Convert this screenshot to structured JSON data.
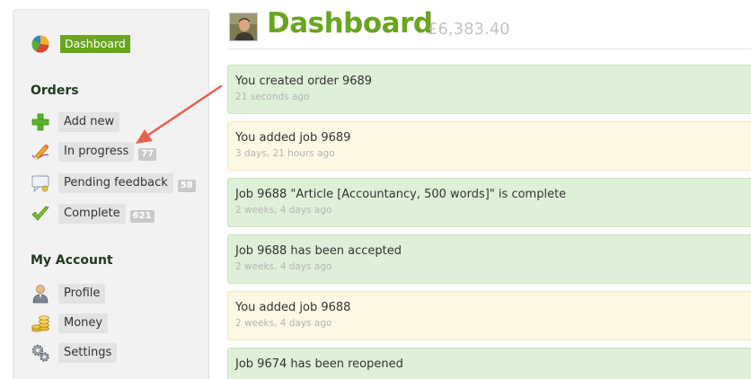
{
  "sidebar": {
    "brand_label": "Dashboard",
    "sections": [
      {
        "title": "Orders"
      },
      {
        "title": "My Account"
      }
    ],
    "orders_items": [
      {
        "label": "Add new",
        "icon": "plus-icon",
        "count": ""
      },
      {
        "label": "In progress",
        "icon": "pencil-icon",
        "count": "77"
      },
      {
        "label": "Pending feedback",
        "icon": "comment-icon",
        "count": "58"
      },
      {
        "label": "Complete",
        "icon": "checkmark-icon",
        "count": "621"
      }
    ],
    "account_items": [
      {
        "label": "Profile",
        "icon": "user-icon"
      },
      {
        "label": "Money",
        "icon": "coins-icon"
      },
      {
        "label": "Settings",
        "icon": "gears-icon"
      }
    ]
  },
  "header": {
    "title": "Dashboard",
    "balance": "£6,383.40"
  },
  "feed": [
    {
      "text": "You created order 9689",
      "time": "21 seconds ago",
      "status": "green"
    },
    {
      "text": "You added job 9689",
      "time": "3 days, 21 hours ago",
      "status": "yellow"
    },
    {
      "text": "Job 9688 \"Article [Accountancy, 500 words]\" is complete",
      "time": "2 weeks, 4 days ago",
      "status": "green"
    },
    {
      "text": "Job 9688 has been accepted",
      "time": "2 weeks, 4 days ago",
      "status": "green"
    },
    {
      "text": "You added job 9688",
      "time": "2 weeks, 4 days ago",
      "status": "yellow"
    },
    {
      "text": "Job 9674 has been reopened",
      "time": "",
      "status": "green"
    }
  ],
  "colors": {
    "brand_green": "#6aa51f",
    "feed_green": "#dff0d8",
    "feed_yellow": "#fcf8e3",
    "annotation_arrow": "#e8604c"
  }
}
